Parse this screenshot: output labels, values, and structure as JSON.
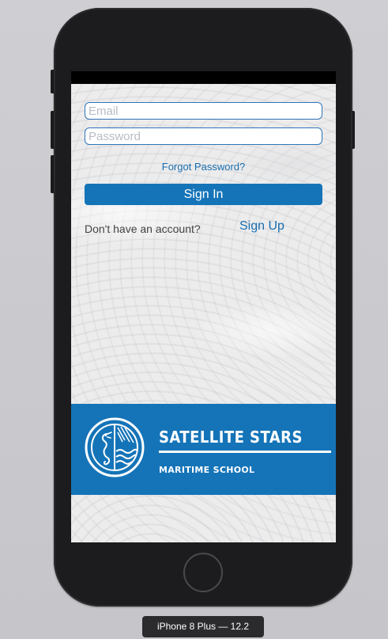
{
  "login": {
    "email_placeholder": "Email",
    "password_placeholder": "Password",
    "forgot_label": "Forgot Password?",
    "signin_label": "Sign In",
    "no_account_text": "Don't have an account?",
    "signup_label": "Sign Up"
  },
  "banner": {
    "title": "SATELLITE STARS",
    "subtitle": "MARITIME SCHOOL",
    "logo_icon": "seahorse-waves-emblem-icon"
  },
  "simulator": {
    "device_label": "iPhone 8 Plus — 12.2"
  },
  "colors": {
    "accent": "#1574b8",
    "link": "#1a6fb0",
    "phone_body": "#1c1c1e"
  }
}
